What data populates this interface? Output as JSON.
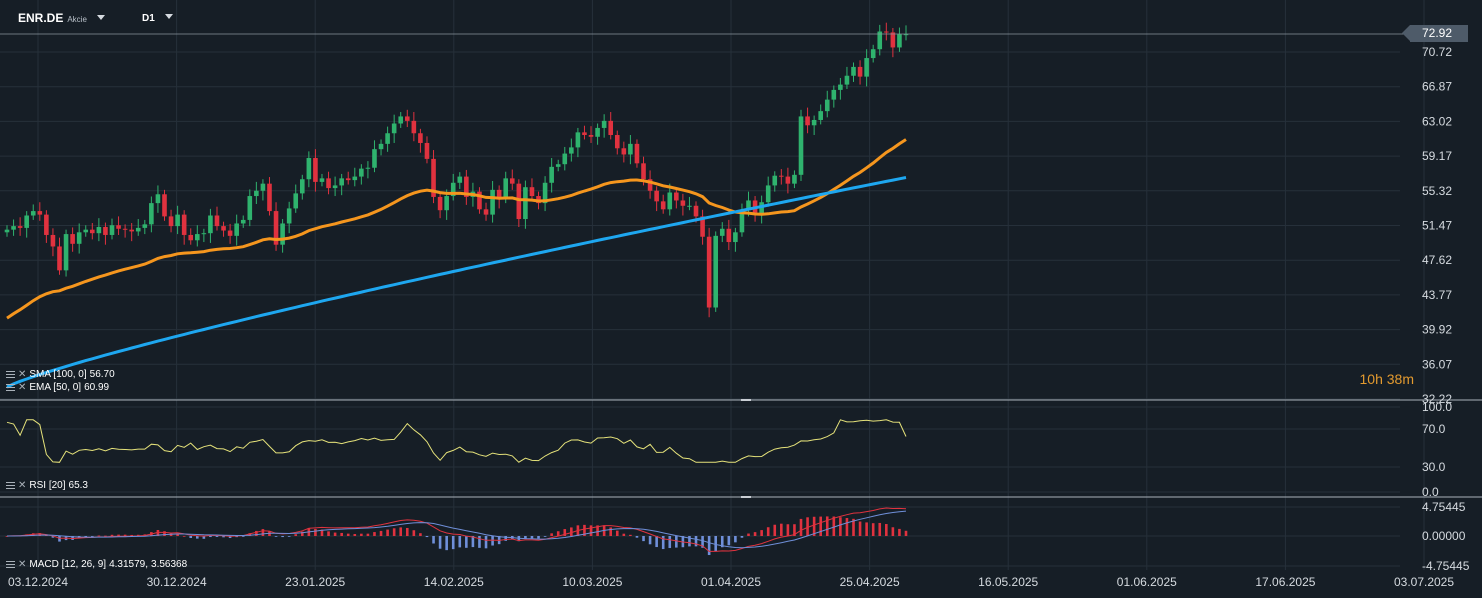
{
  "header": {
    "symbol": "ENR.DE",
    "symbol_type": "Akcie",
    "interval": "D1"
  },
  "last_price_tag": "72.92",
  "timer": {
    "hours": "10",
    "h_label": "h",
    "minutes": "38",
    "m_label": "m"
  },
  "indicators": {
    "sma": {
      "label": "SMA [100, 0]",
      "value": "56.70",
      "color": "#1ea7f0"
    },
    "ema": {
      "label": "EMA [50, 0]",
      "value": "60.99",
      "color": "#f5961e"
    },
    "rsi": {
      "label": "RSI [20]",
      "value": "65.3",
      "color": "#e5e27a"
    },
    "macd": {
      "label": "MACD [12, 26, 9]",
      "value": "4.31579,",
      "signal": "3.56368",
      "macd_color": "#e0333f",
      "signal_color": "#6f8fd9"
    }
  },
  "colors": {
    "up": "#2fb36e",
    "down": "#e0323f",
    "background": "#161e26",
    "grid": "#26303a"
  },
  "chart_data": {
    "type": "candlestick",
    "price_axis": {
      "ticks": [
        "70.72",
        "66.87",
        "63.02",
        "59.17",
        "55.32",
        "51.47",
        "47.62",
        "43.77",
        "39.92",
        "36.07",
        "32.22"
      ],
      "range": [
        32.22,
        74.2
      ]
    },
    "rsi_axis": {
      "ticks": [
        "100.0",
        "70.0",
        "30.0",
        "0.0"
      ],
      "range": [
        0,
        100
      ]
    },
    "macd_axis": {
      "ticks": [
        "4.75445",
        "0.00000",
        "-4.75445"
      ],
      "range": [
        -4.75445,
        4.75445
      ]
    },
    "date_axis": {
      "labels": [
        "03.12.2024",
        "30.12.2024",
        "23.01.2025",
        "14.02.2025",
        "10.03.2025",
        "01.04.2025",
        "25.04.2025",
        "16.05.2025",
        "01.06.2025",
        "17.06.2025",
        "03.07.2025"
      ]
    },
    "candles_close": [
      50.8,
      51.2,
      51.0,
      52.4,
      52.9,
      52.5,
      50.2,
      48.9,
      46.2,
      50.3,
      49.2,
      50.5,
      50.8,
      50.4,
      51.1,
      50.2,
      51.3,
      50.9,
      50.8,
      50.6,
      51.0,
      51.4,
      53.8,
      54.8,
      52.3,
      51.2,
      52.5,
      50.2,
      49.6,
      50.3,
      50.4,
      52.4,
      51.2,
      50.7,
      50.1,
      51.5,
      51.9,
      54.6,
      55.2,
      56.0,
      52.9,
      49.1,
      51.5,
      53.2,
      54.9,
      56.5,
      58.9,
      56.2,
      56.6,
      55.5,
      55.8,
      56.6,
      56.4,
      56.8,
      57.7,
      57.8,
      59.9,
      60.5,
      61.7,
      62.8,
      63.6,
      63.1,
      61.7,
      60.6,
      58.8,
      54.5,
      53.0,
      54.6,
      56.1,
      56.8,
      54.5,
      55.1,
      53.1,
      52.5,
      55.3,
      54.3,
      56.6,
      56.0,
      52.0,
      55.6,
      54.6,
      53.8,
      56.1,
      57.9,
      58.2,
      59.4,
      60.1,
      61.8,
      61.5,
      61.3,
      62.3,
      63.1,
      61.5,
      60.0,
      59.3,
      60.5,
      58.3,
      56.5,
      55.2,
      54.0,
      53.1,
      55.0,
      54.1,
      53.5,
      53.5,
      52.3,
      50.0,
      42.0,
      50.1,
      50.9,
      49.4,
      50.5,
      53.0,
      54.1,
      52.6,
      53.9,
      55.8,
      56.9,
      56.8,
      56.0,
      57.0,
      63.6,
      62.6,
      63.2,
      64.2,
      65.5,
      66.6,
      67.2,
      68.2,
      69.2,
      68.1,
      70.2,
      71.2,
      73.2,
      73.1,
      71.4,
      72.9,
      72.9
    ],
    "sma_100_last": 56.7,
    "ema_50_last": 60.99,
    "rsi_last": 65.3,
    "macd_last": 4.31579,
    "macd_signal_last": 3.56368
  }
}
